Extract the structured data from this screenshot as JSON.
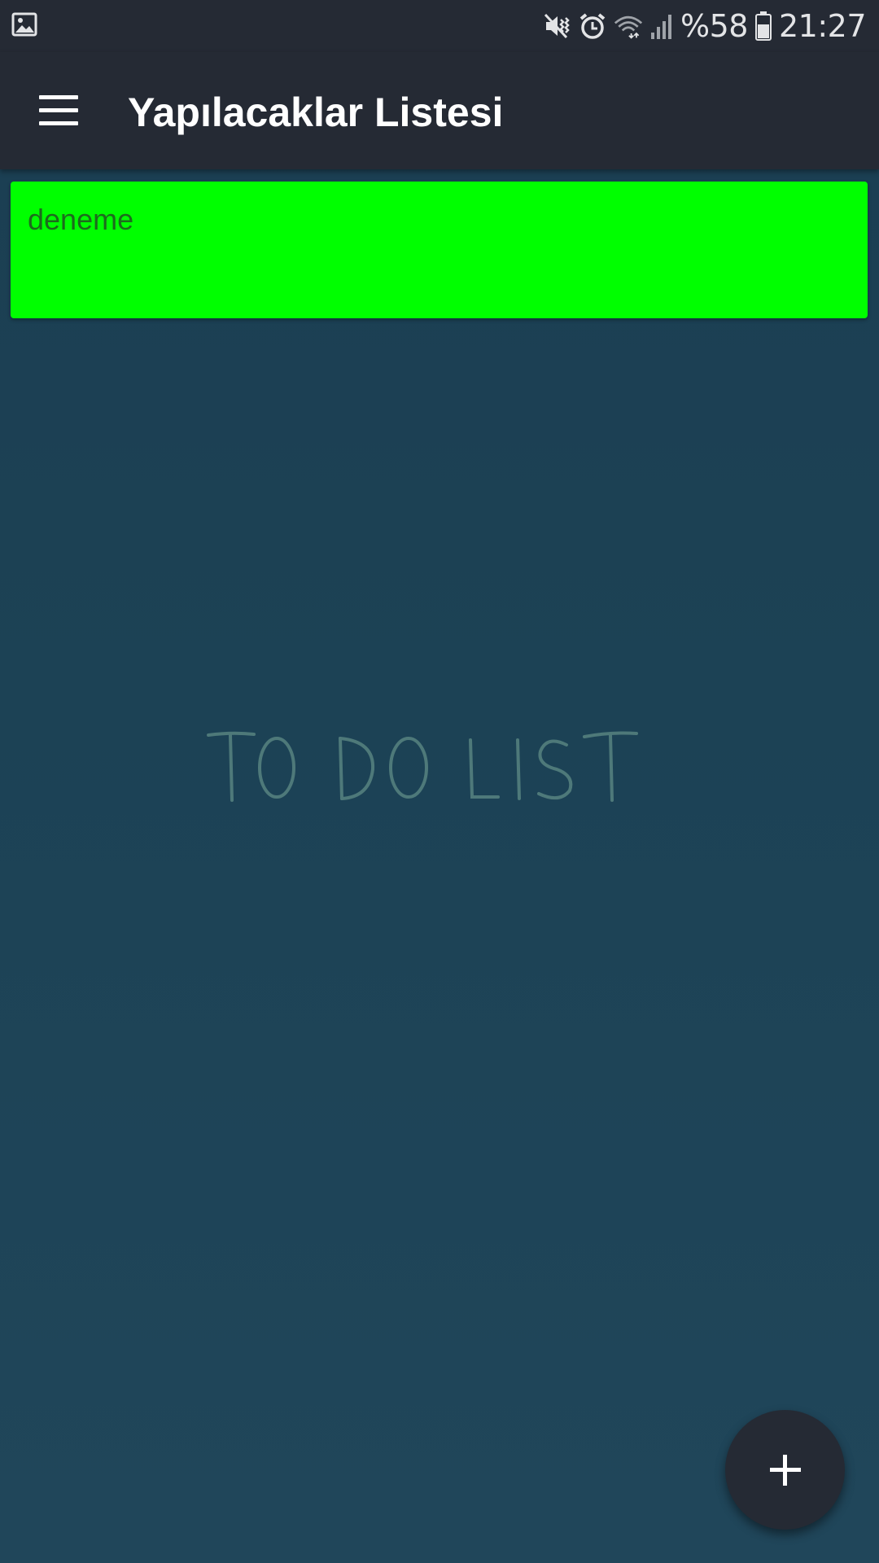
{
  "status_bar": {
    "left_icon": "image-notification-icon",
    "icons": [
      "mute-vibrate-icon",
      "alarm-icon",
      "wifi-icon",
      "cell-signal-icon",
      "battery-icon"
    ],
    "battery_text": "%58",
    "time": "21:27"
  },
  "app_bar": {
    "menu_icon": "hamburger-menu-icon",
    "title": "Yapılacaklar Listesi"
  },
  "todos": [
    {
      "text": "deneme",
      "color": "#00ff00"
    }
  ],
  "watermark": {
    "text": "TO DO LIST",
    "style": "chalk-handwritten"
  },
  "fab": {
    "icon": "plus-icon"
  },
  "colors": {
    "bar": "#252a34",
    "background": "#1c4255",
    "card": "#00ff00",
    "card_text": "#1d6b1d"
  }
}
